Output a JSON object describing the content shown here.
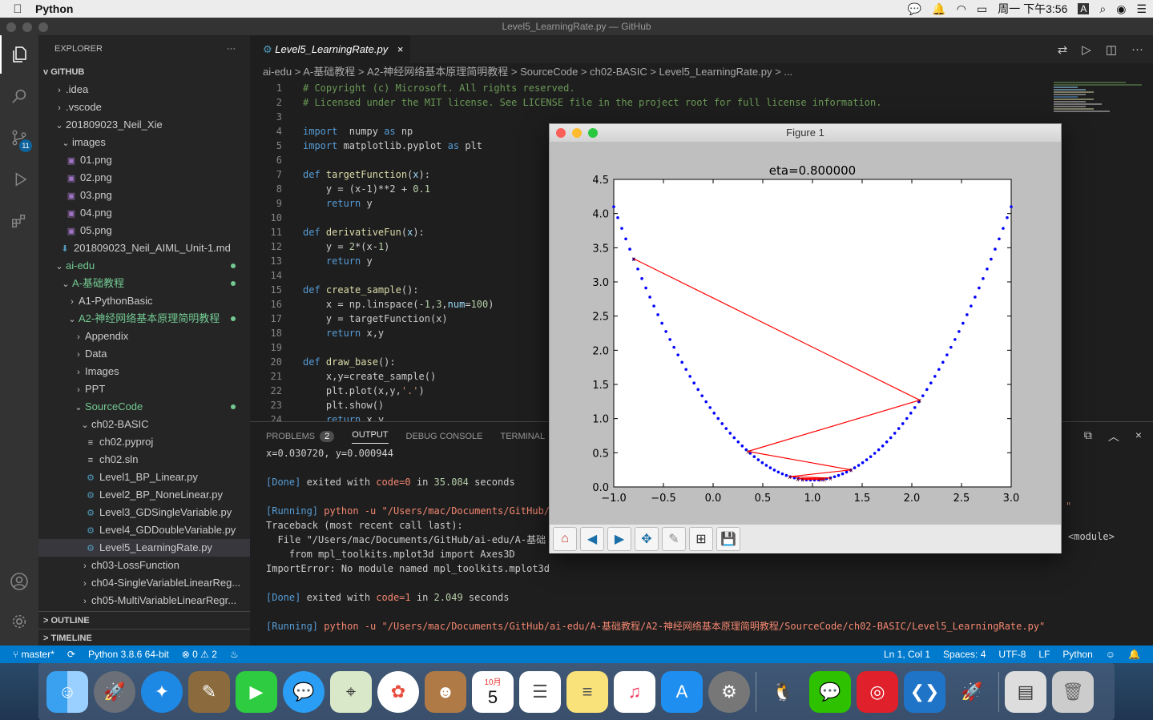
{
  "menubar": {
    "app": "Python",
    "clock": "周一 下午3:56",
    "input": "A"
  },
  "window": {
    "title": "Level5_LearningRate.py — GitHub"
  },
  "sidebar": {
    "title": "EXPLORER",
    "more": "···",
    "root": "GITHUB",
    "tree": [
      {
        "label": ".idea",
        "indent": 1,
        "chev": ">",
        "type": "folder"
      },
      {
        "label": ".vscode",
        "indent": 1,
        "chev": ">",
        "type": "folder"
      },
      {
        "label": "201809023_Neil_Xie",
        "indent": 1,
        "chev": "v",
        "type": "folder"
      },
      {
        "label": "images",
        "indent": 2,
        "chev": "v",
        "type": "folder"
      },
      {
        "label": "01.png",
        "indent": 3,
        "type": "img"
      },
      {
        "label": "02.png",
        "indent": 3,
        "type": "img"
      },
      {
        "label": "03.png",
        "indent": 3,
        "type": "img"
      },
      {
        "label": "04.png",
        "indent": 3,
        "type": "img"
      },
      {
        "label": "05.png",
        "indent": 3,
        "type": "img"
      },
      {
        "label": "201809023_Neil_AIML_Unit-1.md",
        "indent": 2,
        "type": "md"
      },
      {
        "label": "ai-edu",
        "indent": 1,
        "chev": "v",
        "type": "folder",
        "git": true
      },
      {
        "label": "A-基础教程",
        "indent": 2,
        "chev": "v",
        "type": "folder",
        "git": true
      },
      {
        "label": "A1-PythonBasic",
        "indent": 3,
        "chev": ">",
        "type": "folder"
      },
      {
        "label": "A2-神经网络基本原理简明教程",
        "indent": 3,
        "chev": "v",
        "type": "folder",
        "git": true
      },
      {
        "label": "Appendix",
        "indent": 4,
        "chev": ">",
        "type": "folder"
      },
      {
        "label": "Data",
        "indent": 4,
        "chev": ">",
        "type": "folder"
      },
      {
        "label": "Images",
        "indent": 4,
        "chev": ">",
        "type": "folder"
      },
      {
        "label": "PPT",
        "indent": 4,
        "chev": ">",
        "type": "folder"
      },
      {
        "label": "SourceCode",
        "indent": 4,
        "chev": "v",
        "type": "folder",
        "git": true
      },
      {
        "label": "ch02-BASIC",
        "indent": 5,
        "chev": "v",
        "type": "folder"
      },
      {
        "label": "ch02.pyproj",
        "indent": 6,
        "type": "txt"
      },
      {
        "label": "ch02.sln",
        "indent": 6,
        "type": "txt"
      },
      {
        "label": "Level1_BP_Linear.py",
        "indent": 6,
        "type": "py"
      },
      {
        "label": "Level2_BP_NoneLinear.py",
        "indent": 6,
        "type": "py"
      },
      {
        "label": "Level3_GDSingleVariable.py",
        "indent": 6,
        "type": "py"
      },
      {
        "label": "Level4_GDDoubleVariable.py",
        "indent": 6,
        "type": "py"
      },
      {
        "label": "Level5_LearningRate.py",
        "indent": 6,
        "type": "py",
        "selected": true
      },
      {
        "label": "ch03-LossFunction",
        "indent": 5,
        "chev": ">",
        "type": "folder"
      },
      {
        "label": "ch04-SingleVariableLinearReg...",
        "indent": 5,
        "chev": ">",
        "type": "folder"
      },
      {
        "label": "ch05-MultiVariableLinearRegr...",
        "indent": 5,
        "chev": ">",
        "type": "folder"
      }
    ],
    "outline": "OUTLINE",
    "timeline": "TIMELINE"
  },
  "editor": {
    "tab": "Level5_LearningRate.py",
    "breadcrumb": "ai-edu  >  A-基础教程  >  A2-神经网络基本原理简明教程  >  SourceCode  >  ch02-BASIC  >  Level5_LearningRate.py  >  ...",
    "lines": [
      [
        [
          "cm",
          "# Copyright (c) Microsoft. All rights reserved."
        ]
      ],
      [
        [
          "cm",
          "# Licensed under the MIT license. See LICENSE file in the project root for full license information."
        ]
      ],
      [],
      [
        [
          "kw",
          "import"
        ],
        [
          "",
          "  numpy "
        ],
        [
          "kw",
          "as"
        ],
        [
          "",
          " np"
        ]
      ],
      [
        [
          "kw",
          "import"
        ],
        [
          "",
          " matplotlib.pyplot "
        ],
        [
          "kw",
          "as"
        ],
        [
          "",
          " plt"
        ]
      ],
      [],
      [
        [
          "kw",
          "def"
        ],
        [
          "fn",
          " targetFunction"
        ],
        [
          "",
          "("
        ],
        [
          "pa",
          "x"
        ],
        [
          "",
          "):"
        ]
      ],
      [
        [
          "",
          "    y = (x-1)**2 + "
        ],
        [
          "nm",
          "0.1"
        ]
      ],
      [
        [
          "kw",
          "    return"
        ],
        [
          "",
          " y"
        ]
      ],
      [],
      [
        [
          "kw",
          "def"
        ],
        [
          "fn",
          " derivativeFun"
        ],
        [
          "",
          "("
        ],
        [
          "pa",
          "x"
        ],
        [
          "",
          "):"
        ]
      ],
      [
        [
          "",
          "    y = "
        ],
        [
          "nm",
          "2"
        ],
        [
          "",
          "*(x-"
        ],
        [
          "nm",
          "1"
        ],
        [
          "",
          ")"
        ]
      ],
      [
        [
          "kw",
          "    return"
        ],
        [
          "",
          " y"
        ]
      ],
      [],
      [
        [
          "kw",
          "def"
        ],
        [
          "fn",
          " create_sample"
        ],
        [
          "",
          "():"
        ]
      ],
      [
        [
          "",
          "    x = np.linspace(-"
        ],
        [
          "nm",
          "1"
        ],
        [
          "",
          ","
        ],
        [
          "nm",
          "3"
        ],
        [
          "",
          ","
        ],
        [
          "pa",
          "num"
        ],
        [
          "",
          "="
        ],
        [
          "nm",
          "100"
        ],
        [
          "",
          ")"
        ]
      ],
      [
        [
          "",
          "    y = targetFunction(x)"
        ]
      ],
      [
        [
          "kw",
          "    return"
        ],
        [
          "",
          " x,y"
        ]
      ],
      [],
      [
        [
          "kw",
          "def"
        ],
        [
          "fn",
          " draw_base"
        ],
        [
          "",
          "():"
        ]
      ],
      [
        [
          "",
          "    x,y=create_sample()"
        ]
      ],
      [
        [
          "",
          "    plt.plot(x,y,"
        ],
        [
          "st",
          "'.'"
        ],
        [
          "",
          ")"
        ]
      ],
      [
        [
          "",
          "    plt.show()"
        ]
      ],
      [
        [
          "kw",
          "    return"
        ],
        [
          "",
          " x,y"
        ]
      ]
    ]
  },
  "panel": {
    "tabs": [
      "PROBLEMS",
      "OUTPUT",
      "DEBUG CONSOLE",
      "TERMINAL"
    ],
    "problems_count": "2",
    "output": [
      [
        [
          "",
          "x=0.030720, y=0.000944"
        ]
      ],
      [],
      [
        [
          "ok",
          "[Done]"
        ],
        [
          "",
          " exited with "
        ],
        [
          "red",
          "code=0"
        ],
        [
          "",
          " in "
        ],
        [
          "cy",
          "35.084"
        ],
        [
          "",
          " seconds"
        ]
      ],
      [],
      [
        [
          "ok",
          "[Running]"
        ],
        [
          "red",
          " python -u \"/Users/mac/Documents/GitHub/"
        ]
      ],
      [
        [
          "",
          "Traceback (most recent call last):"
        ]
      ],
      [
        [
          "",
          "  File \"/Users/mac/Documents/GitHub/ai-edu/A-基础"
        ]
      ],
      [
        [
          "",
          "    from mpl_toolkits.mplot3d import Axes3D"
        ]
      ],
      [
        [
          "",
          "ImportError: No module named mpl_toolkits.mplot3d"
        ]
      ],
      [],
      [
        [
          "ok",
          "[Done]"
        ],
        [
          "",
          " exited with "
        ],
        [
          "red",
          "code=1"
        ],
        [
          "",
          " in "
        ],
        [
          "cy",
          "2.049"
        ],
        [
          "",
          " seconds"
        ]
      ],
      [],
      [
        [
          "ok",
          "[Running]"
        ],
        [
          "red",
          " python -u \"/Users/mac/Documents/GitHub/ai-edu/A-基础教程/A2-神经网络基本原理简明教程/SourceCode/ch02-BASIC/Level5_LearningRate.py\""
        ]
      ]
    ],
    "module_text": "<module>"
  },
  "status": {
    "branch": "master*",
    "python": "Python 3.8.6 64-bit",
    "errors": "0",
    "warnings": "2",
    "position": "Ln 1, Col 1",
    "spaces": "Spaces: 4",
    "encoding": "UTF-8",
    "eol": "LF",
    "language": "Python"
  },
  "dock": {
    "calendar_month": "10月",
    "calendar_day": "5"
  },
  "figure": {
    "window_title": "Figure 1"
  },
  "chart_data": {
    "type": "scatter+line",
    "title": "eta=0.800000",
    "xlim": [
      -1.0,
      3.0
    ],
    "ylim": [
      0.0,
      4.5
    ],
    "xticks": [
      "−1.0",
      "−0.5",
      "0.0",
      "0.5",
      "1.0",
      "1.5",
      "2.0",
      "2.5",
      "3.0"
    ],
    "yticks": [
      "0.0",
      "0.5",
      "1.0",
      "1.5",
      "2.0",
      "2.5",
      "3.0",
      "3.5",
      "4.0",
      "4.5"
    ],
    "series": [
      {
        "style": "dots",
        "color": "#0000ff",
        "function": "(x-1)^2+0.1",
        "x_range": [
          -1,
          3
        ],
        "num": 100
      },
      {
        "style": "line",
        "color": "#ff0000",
        "points": [
          [
            -0.8,
            3.34
          ],
          [
            2.08,
            1.27
          ],
          [
            0.35,
            0.52
          ],
          [
            1.39,
            0.25
          ],
          [
            0.77,
            0.15
          ],
          [
            1.18,
            0.13
          ],
          [
            0.85,
            0.12
          ],
          [
            1.12,
            0.11
          ],
          [
            0.9,
            0.11
          ],
          [
            1.08,
            0.11
          ]
        ]
      }
    ]
  }
}
